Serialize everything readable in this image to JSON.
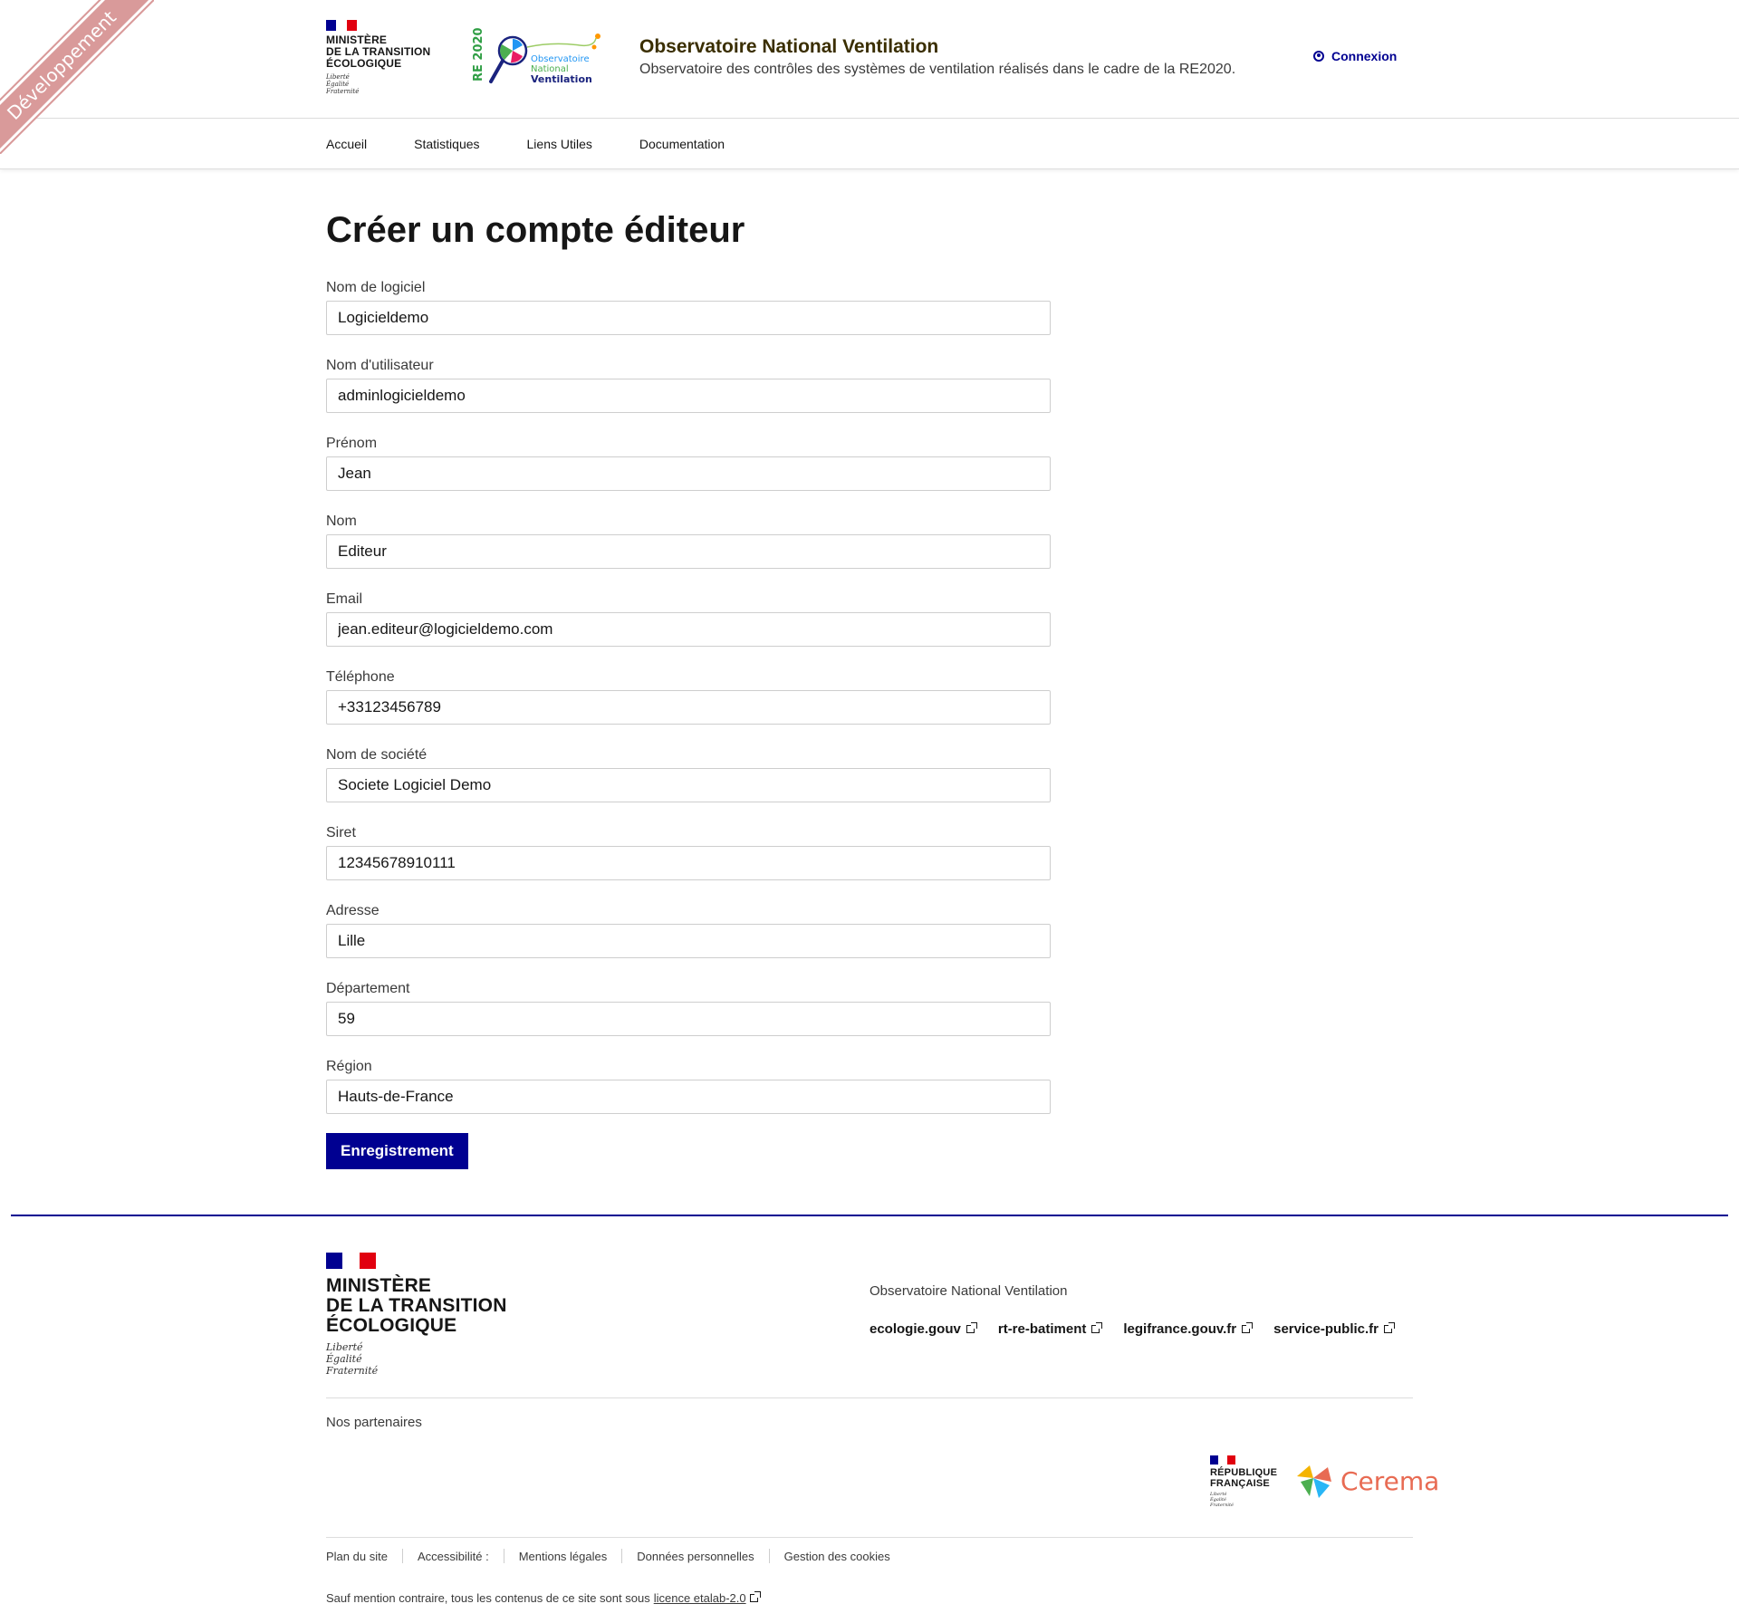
{
  "ribbon": {
    "label": "Développement"
  },
  "header": {
    "ministry_lines": [
      "Ministère",
      "de la transition",
      "écologique"
    ],
    "devise": [
      "Liberté",
      "Égalité",
      "Fraternité"
    ],
    "logo_text": {
      "re": "RE 2020",
      "line1": "Observatoire",
      "line2": "National",
      "line3": "Ventilation"
    },
    "title": "Observatoire National Ventilation",
    "tagline": "Observatoire des contrôles des systèmes de ventilation réalisés dans le cadre de la RE2020.",
    "login_label": "Connexion"
  },
  "nav": {
    "items": [
      "Accueil",
      "Statistiques",
      "Liens Utiles",
      "Documentation"
    ]
  },
  "page": {
    "title": "Créer un compte éditeur",
    "fields": [
      {
        "label": "Nom de logiciel",
        "value": "Logicieldemo"
      },
      {
        "label": "Nom d'utilisateur",
        "value": "adminlogicieldemo"
      },
      {
        "label": "Prénom",
        "value": "Jean"
      },
      {
        "label": "Nom",
        "value": "Editeur"
      },
      {
        "label": "Email",
        "value": "jean.editeur@logicieldemo.com"
      },
      {
        "label": "Téléphone",
        "value": "+33123456789"
      },
      {
        "label": "Nom de société",
        "value": "Societe Logiciel Demo"
      },
      {
        "label": "Siret",
        "value": "12345678910111"
      },
      {
        "label": "Adresse",
        "value": "Lille"
      },
      {
        "label": "Département",
        "value": "59"
      },
      {
        "label": "Région",
        "value": "Hauts-de-France"
      }
    ],
    "submit_label": "Enregistrement"
  },
  "footer": {
    "ministry_lines": [
      "Ministère",
      "de la transition",
      "écologique"
    ],
    "devise": [
      "Liberté",
      "Égalité",
      "Fraternité"
    ],
    "description": "Observatoire National Ventilation",
    "links": [
      "ecologie.gouv",
      "rt-re-batiment",
      "legifrance.gouv.fr",
      "service-public.fr"
    ],
    "partners_label": "Nos partenaires",
    "partner_rf": {
      "lines": [
        "République",
        "Française"
      ],
      "devise": [
        "Liberté",
        "Égalité",
        "Fraternité"
      ]
    },
    "partner_cerema": "Cerema",
    "bottom_links": [
      "Plan du site",
      "Accessibilité :",
      "Mentions légales",
      "Données personnelles",
      "Gestion des cookies"
    ],
    "legal_prefix": "Sauf mention contraire, tous les contenus de ce site sont sous",
    "legal_link": "licence etalab-2.0"
  },
  "colors": {
    "primary": "#000091",
    "ribbon": "#d99a9a",
    "cerema": "#e86b53"
  }
}
